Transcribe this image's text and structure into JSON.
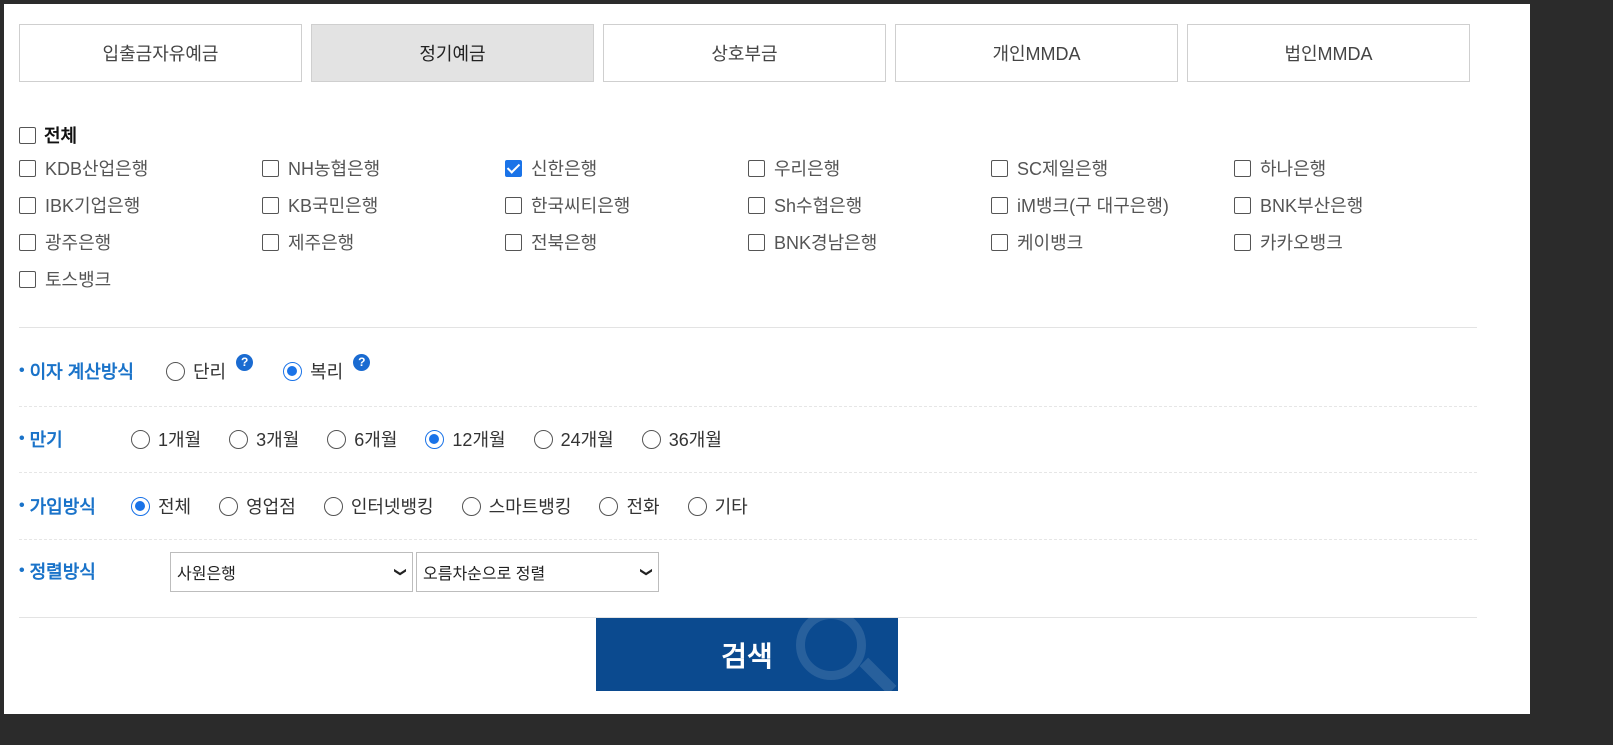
{
  "tabs": [
    {
      "label": "입출금자유예금",
      "active": false
    },
    {
      "label": "정기예금",
      "active": true
    },
    {
      "label": "상호부금",
      "active": false
    },
    {
      "label": "개인MMDA",
      "active": false
    },
    {
      "label": "법인MMDA",
      "active": false
    }
  ],
  "banks": {
    "all_label": "전체",
    "items": [
      {
        "label": "KDB산업은행",
        "checked": false
      },
      {
        "label": "NH농협은행",
        "checked": false
      },
      {
        "label": "신한은행",
        "checked": true
      },
      {
        "label": "우리은행",
        "checked": false
      },
      {
        "label": "SC제일은행",
        "checked": false
      },
      {
        "label": "하나은행",
        "checked": false
      },
      {
        "label": "IBK기업은행",
        "checked": false
      },
      {
        "label": "KB국민은행",
        "checked": false
      },
      {
        "label": "한국씨티은행",
        "checked": false
      },
      {
        "label": "Sh수협은행",
        "checked": false
      },
      {
        "label": "iM뱅크(구 대구은행)",
        "checked": false
      },
      {
        "label": "BNK부산은행",
        "checked": false
      },
      {
        "label": "광주은행",
        "checked": false
      },
      {
        "label": "제주은행",
        "checked": false
      },
      {
        "label": "전북은행",
        "checked": false
      },
      {
        "label": "BNK경남은행",
        "checked": false
      },
      {
        "label": "케이뱅크",
        "checked": false
      },
      {
        "label": "카카오뱅크",
        "checked": false
      },
      {
        "label": "토스뱅크",
        "checked": false
      }
    ]
  },
  "interest": {
    "label": "이자 계산방식",
    "options": [
      {
        "label": "단리",
        "selected": false
      },
      {
        "label": "복리",
        "selected": true
      }
    ],
    "help_glyph": "?"
  },
  "term": {
    "label": "만기",
    "options": [
      {
        "label": "1개월",
        "selected": false
      },
      {
        "label": "3개월",
        "selected": false
      },
      {
        "label": "6개월",
        "selected": false
      },
      {
        "label": "12개월",
        "selected": true
      },
      {
        "label": "24개월",
        "selected": false
      },
      {
        "label": "36개월",
        "selected": false
      }
    ]
  },
  "join": {
    "label": "가입방식",
    "options": [
      {
        "label": "전체",
        "selected": true
      },
      {
        "label": "영업점",
        "selected": false
      },
      {
        "label": "인터넷뱅킹",
        "selected": false
      },
      {
        "label": "스마트뱅킹",
        "selected": false
      },
      {
        "label": "전화",
        "selected": false
      },
      {
        "label": "기타",
        "selected": false
      }
    ]
  },
  "sort": {
    "label": "정렬방식",
    "field_value": "사원은행",
    "order_value": "오름차순으로 정렬"
  },
  "search": {
    "label": "검색"
  },
  "colors": {
    "accent": "#1a73e8",
    "label_blue": "#1a73c9",
    "search_bg": "#0b4a8f"
  }
}
